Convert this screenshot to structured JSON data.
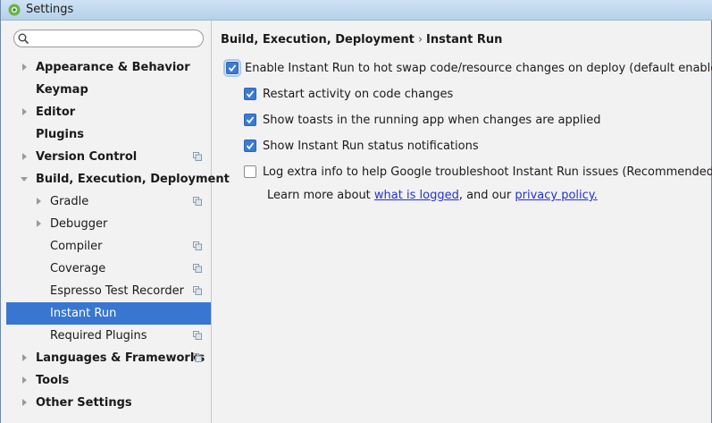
{
  "window": {
    "title": "Settings"
  },
  "search": {
    "placeholder": "",
    "value": ""
  },
  "sidebar": {
    "items": [
      {
        "label": "Appearance & Behavior",
        "bold": true,
        "arrow": "right",
        "level": 0,
        "project": false
      },
      {
        "label": "Keymap",
        "bold": true,
        "arrow": "none",
        "level": 0,
        "project": false
      },
      {
        "label": "Editor",
        "bold": true,
        "arrow": "right",
        "level": 0,
        "project": false
      },
      {
        "label": "Plugins",
        "bold": true,
        "arrow": "none",
        "level": 0,
        "project": false
      },
      {
        "label": "Version Control",
        "bold": true,
        "arrow": "right",
        "level": 0,
        "project": true
      },
      {
        "label": "Build, Execution, Deployment",
        "bold": true,
        "arrow": "down",
        "level": 0,
        "project": false
      },
      {
        "label": "Gradle",
        "bold": false,
        "arrow": "right",
        "level": 1,
        "project": true
      },
      {
        "label": "Debugger",
        "bold": false,
        "arrow": "right",
        "level": 1,
        "project": false
      },
      {
        "label": "Compiler",
        "bold": false,
        "arrow": "none",
        "level": 1,
        "project": true
      },
      {
        "label": "Coverage",
        "bold": false,
        "arrow": "none",
        "level": 1,
        "project": true
      },
      {
        "label": "Espresso Test Recorder",
        "bold": false,
        "arrow": "none",
        "level": 1,
        "project": true
      },
      {
        "label": "Instant Run",
        "bold": false,
        "arrow": "none",
        "level": 1,
        "project": false,
        "selected": true
      },
      {
        "label": "Required Plugins",
        "bold": false,
        "arrow": "none",
        "level": 1,
        "project": true
      },
      {
        "label": "Languages & Frameworks",
        "bold": true,
        "arrow": "right",
        "level": 0,
        "project": true
      },
      {
        "label": "Tools",
        "bold": true,
        "arrow": "right",
        "level": 0,
        "project": false
      },
      {
        "label": "Other Settings",
        "bold": true,
        "arrow": "right",
        "level": 0,
        "project": false
      }
    ]
  },
  "breadcrumb": {
    "parent": "Build, Execution, Deployment",
    "separator": "›",
    "current": "Instant Run"
  },
  "options": [
    {
      "label": "Enable Instant Run to hot swap code/resource changes on deploy (default enabled)",
      "checked": true,
      "indent": 0
    },
    {
      "label": "Restart activity on code changes",
      "checked": true,
      "indent": 1
    },
    {
      "label": "Show toasts in the running app when changes are applied",
      "checked": true,
      "indent": 1
    },
    {
      "label": "Show Instant Run status notifications",
      "checked": true,
      "indent": 1
    },
    {
      "label": "Log extra info to help Google troubleshoot Instant Run issues (Recommended)",
      "checked": false,
      "indent": 1
    }
  ],
  "learn_more": {
    "prefix": "Learn more about ",
    "link1": "what is logged",
    "middle": ", and our ",
    "link2": "privacy policy."
  },
  "colors": {
    "selection": "#3876d1",
    "checkbox": "#3a7bd5",
    "link": "#2233cc"
  }
}
